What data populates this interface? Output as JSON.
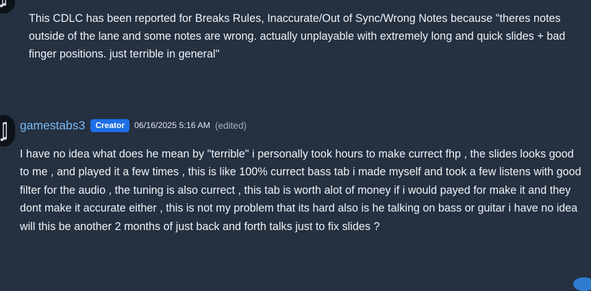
{
  "report_comment": {
    "avatar_icon": "music-note-icon",
    "text": "This CDLC has been reported for Breaks Rules, Inaccurate/Out of Sync/Wrong Notes because \"theres notes outside of the lane and some notes are wrong. actually unplayable with extremely long and quick slides + bad finger positions. just terrible in general\""
  },
  "reply_comment": {
    "avatar_icon": "music-note-icon",
    "username": "gamestabs3",
    "role_badge": "Creator",
    "timestamp": "06/16/2025 5:16 AM",
    "edited_label": "(edited)",
    "text": "I have no idea what does he mean by \"terrible\" i personally took hours to make currect fhp , the slides looks good to me , and played it a few times , this is like 100% currect bass tab i made myself and took a few listens with good filter for the audio , the tuning is also currect , this tab is worth alot of money if i would payed for make it and they dont make it accurate either , this is not my problem that its hard also is he talking on bass or guitar i have no idea will this be another 2 months of just back and forth talks just to fix slides ?"
  },
  "colors": {
    "background": "#253040",
    "username": "#79b8f3",
    "badge": "#1d6fe6",
    "muted": "#a6afba"
  }
}
